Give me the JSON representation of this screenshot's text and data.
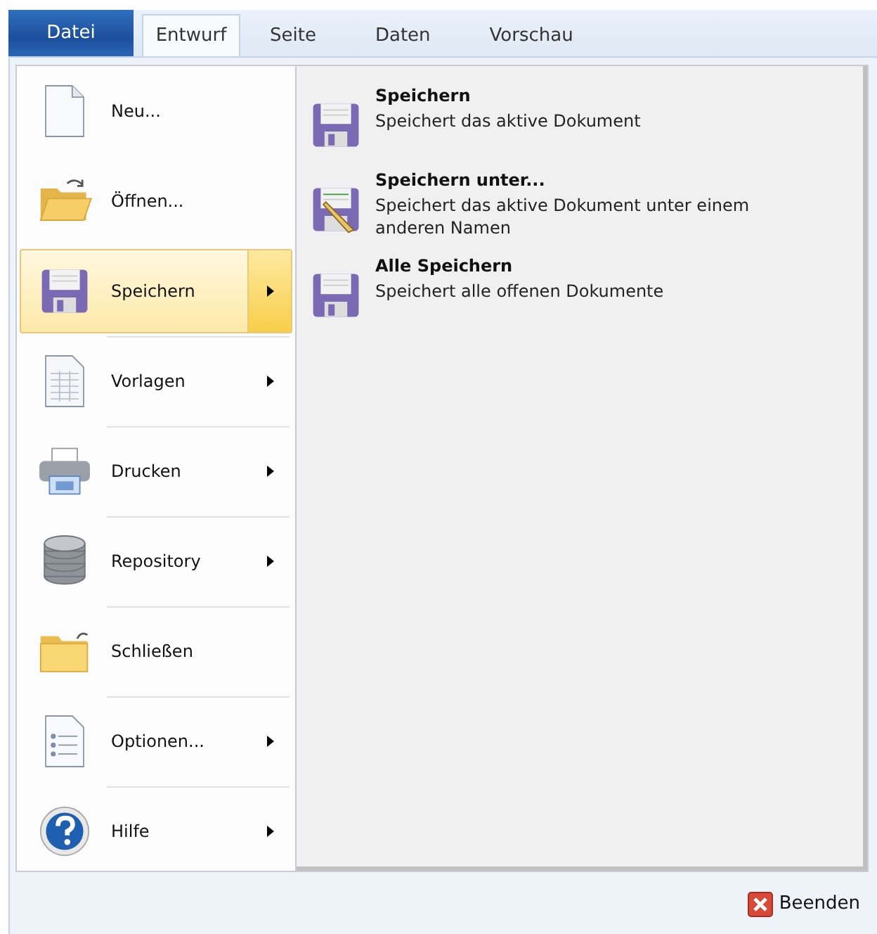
{
  "file_menu": {
    "label": "Datei"
  },
  "tabs": [
    {
      "label": "Entwurf",
      "selected": true
    },
    {
      "label": "Seite",
      "selected": false
    },
    {
      "label": "Daten",
      "selected": false
    },
    {
      "label": "Vorschau",
      "selected": false
    }
  ],
  "menu_items": [
    {
      "label": "Neu...",
      "selected": false,
      "has_submenu": false
    },
    {
      "label": "Öffnen...",
      "selected": false,
      "has_submenu": false
    },
    {
      "label": "Speichern",
      "selected": true,
      "has_submenu": true
    },
    {
      "label": "Vorlagen",
      "selected": false,
      "has_submenu": true
    },
    {
      "label": "Drucken",
      "selected": false,
      "has_submenu": true
    },
    {
      "label": "Repository",
      "selected": false,
      "has_submenu": true
    },
    {
      "label": "Schließen",
      "selected": false,
      "has_submenu": false
    },
    {
      "label": "Optionen...",
      "selected": false,
      "has_submenu": true
    },
    {
      "label": "Hilfe",
      "selected": false,
      "has_submenu": true
    }
  ],
  "submenu": [
    {
      "title": "Speichern",
      "description": "Speichert das aktive Dokument"
    },
    {
      "title": "Speichern unter...",
      "description": "Speichert das aktive Dokument unter einem anderen Namen"
    },
    {
      "title": "Alle Speichern",
      "description": "Speichert alle offenen Dokumente"
    }
  ],
  "footer": {
    "exit_button": {
      "label": "Beenden"
    }
  }
}
